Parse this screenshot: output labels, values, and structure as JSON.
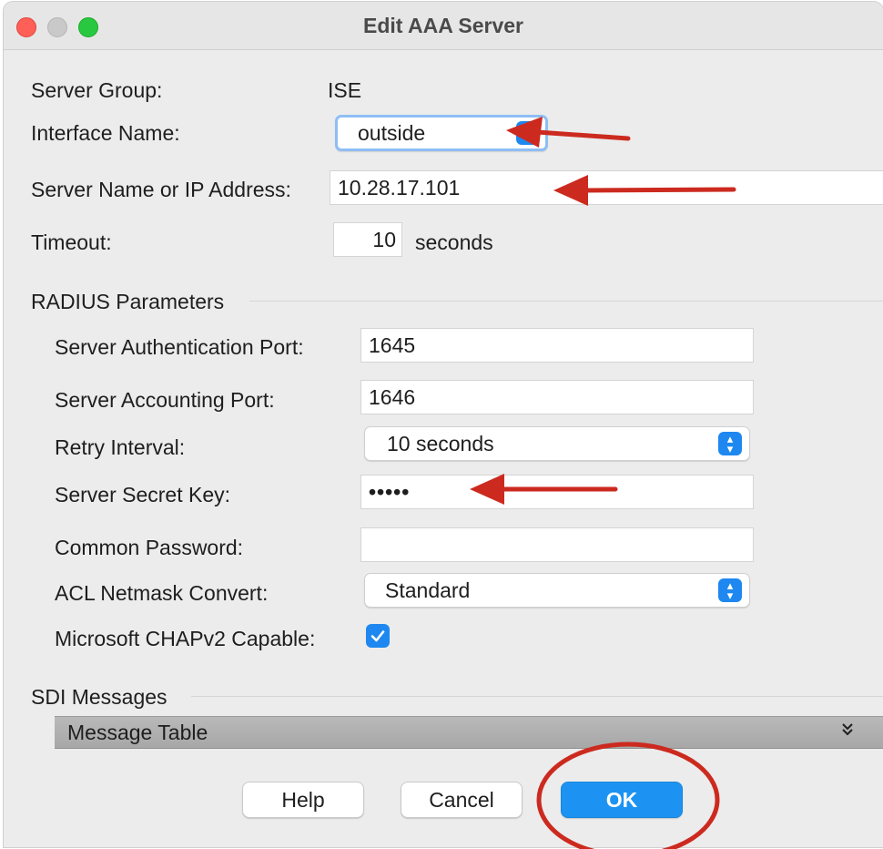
{
  "window": {
    "title": "Edit AAA Server"
  },
  "colors": {
    "accent": "#1e88f0",
    "annotation": "#cc2a1f"
  },
  "fields": {
    "server_group": {
      "label": "Server Group:",
      "value": "ISE"
    },
    "interface_name": {
      "label": "Interface Name:",
      "value": "outside"
    },
    "server_address": {
      "label": "Server Name or IP Address:",
      "value": "10.28.17.101"
    },
    "timeout": {
      "label": "Timeout:",
      "value": "10",
      "unit": "seconds"
    }
  },
  "radius": {
    "title": "RADIUS Parameters",
    "auth_port": {
      "label": "Server Authentication Port:",
      "value": "1645"
    },
    "acct_port": {
      "label": "Server Accounting Port:",
      "value": "1646"
    },
    "retry_interval": {
      "label": "Retry Interval:",
      "value": "10 seconds"
    },
    "secret_key": {
      "label": "Server Secret Key:",
      "value": "•••••"
    },
    "common_password": {
      "label": "Common Password:",
      "value": ""
    },
    "acl_netmask": {
      "label": "ACL Netmask Convert:",
      "value": "Standard"
    },
    "chapv2": {
      "label": "Microsoft CHAPv2 Capable:",
      "checked": true
    }
  },
  "sdi": {
    "title": "SDI Messages",
    "table_label": "Message Table",
    "expand_icon": "»"
  },
  "buttons": {
    "help": "Help",
    "cancel": "Cancel",
    "ok": "OK"
  },
  "icons": {
    "stepper": "up-down-stepper-icon",
    "check": "checkmark-icon"
  }
}
